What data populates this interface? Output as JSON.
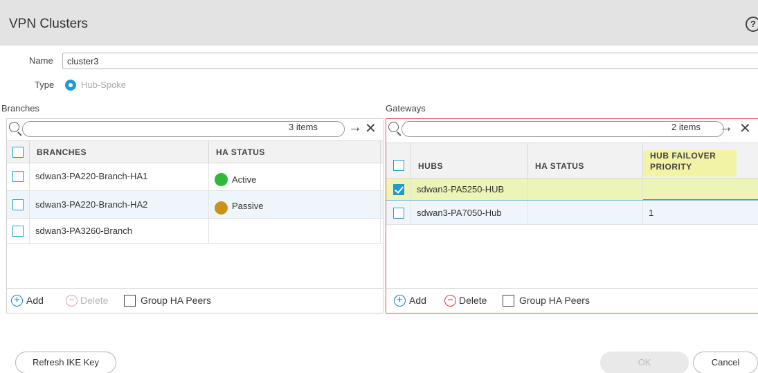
{
  "dialog": {
    "title": "VPN Clusters",
    "help_symbol": "?"
  },
  "form": {
    "name_label": "Name",
    "name_value": "cluster3",
    "type_label": "Type",
    "type_value": "Hub-Spoke"
  },
  "branches": {
    "section_label": "Branches",
    "items_count": "3 items",
    "columns": [
      "BRANCHES",
      "HA STATUS"
    ],
    "rows": [
      {
        "name": "sdwan3-PA220-Branch-HA1",
        "status": "Active",
        "status_color": "#2fb83a",
        "checked": false
      },
      {
        "name": "sdwan3-PA220-Branch-HA2",
        "status": "Passive",
        "status_color": "#c9921a",
        "checked": false
      },
      {
        "name": "sdwan3-PA3260-Branch",
        "status": "",
        "status_color": "",
        "checked": false
      }
    ],
    "toolbar": {
      "add": "Add",
      "delete": "Delete",
      "group_ha_peers": "Group HA Peers"
    }
  },
  "gateways": {
    "section_label": "Gateways",
    "items_count": "2 items",
    "columns": [
      "HUBS",
      "HA STATUS",
      "HUB FAILOVER PRIORITY"
    ],
    "rows": [
      {
        "name": "sdwan3-PA5250-HUB",
        "status": "",
        "priority": "",
        "checked": true
      },
      {
        "name": "sdwan3-PA7050-Hub",
        "status": "",
        "priority": "1",
        "checked": false
      }
    ],
    "toolbar": {
      "add": "Add",
      "delete": "Delete",
      "group_ha_peers": "Group HA Peers"
    }
  },
  "footer": {
    "refresh_label": "Refresh IKE Key",
    "ok_label": "OK",
    "cancel_label": "Cancel"
  },
  "colors": {
    "accent": "#1e9bd7",
    "selected_row": "#ecf4b8",
    "highlight_header": "#f3f3a6",
    "panel_border_active": "#e0424f"
  }
}
